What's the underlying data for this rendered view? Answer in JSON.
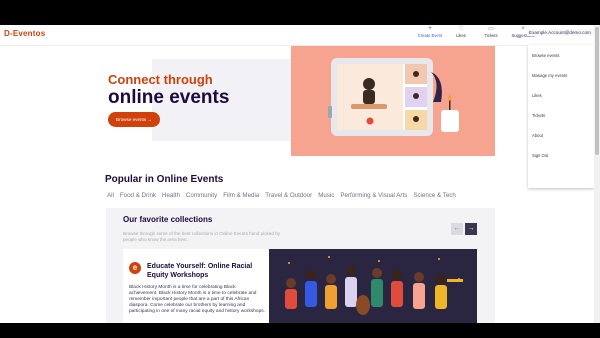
{
  "brand": "D-Eventos",
  "nav": {
    "create_event": "Create Event",
    "likes": "Likes",
    "tickets": "Tickets",
    "suggestions": "Suggestions",
    "account": "Example.Account@demo.com"
  },
  "menu": [
    "Browse events",
    "Manage my events",
    "Likes",
    "Tickets",
    "About",
    "Sign Out"
  ],
  "hero": {
    "subtitle": "Connect through",
    "title": "online events",
    "browse_button": "Browse events →"
  },
  "popular": {
    "heading": "Popular in Online Events",
    "categories": [
      "All",
      "Food & Drink",
      "Health",
      "Community",
      "Film & Media",
      "Travel & Outdoor",
      "Music",
      "Performing & Visual Arts",
      "Science & Tech"
    ]
  },
  "collections": {
    "title": "Our favorite collections",
    "subtitle": "Browse through some of the best collections in Online Events hand picked by people who know the area best.",
    "prev_icon": "←",
    "next_icon": "→",
    "card": {
      "logo_letter": "e",
      "title": "Educate Yourself: Online Racial Equity Workshops",
      "body": "Black History Month is a time for celebrating Black achievement. Black History Month is a time to celebrate and remember important people that are a part of this African diaspora. Come celebrate our brothers by learning and participating in one of many racial equity and history workshops."
    }
  },
  "colors": {
    "brand": "#d1410c",
    "hero_panel": "#f6a48f",
    "dark_text": "#1e0a3c",
    "link": "#3659e3"
  }
}
